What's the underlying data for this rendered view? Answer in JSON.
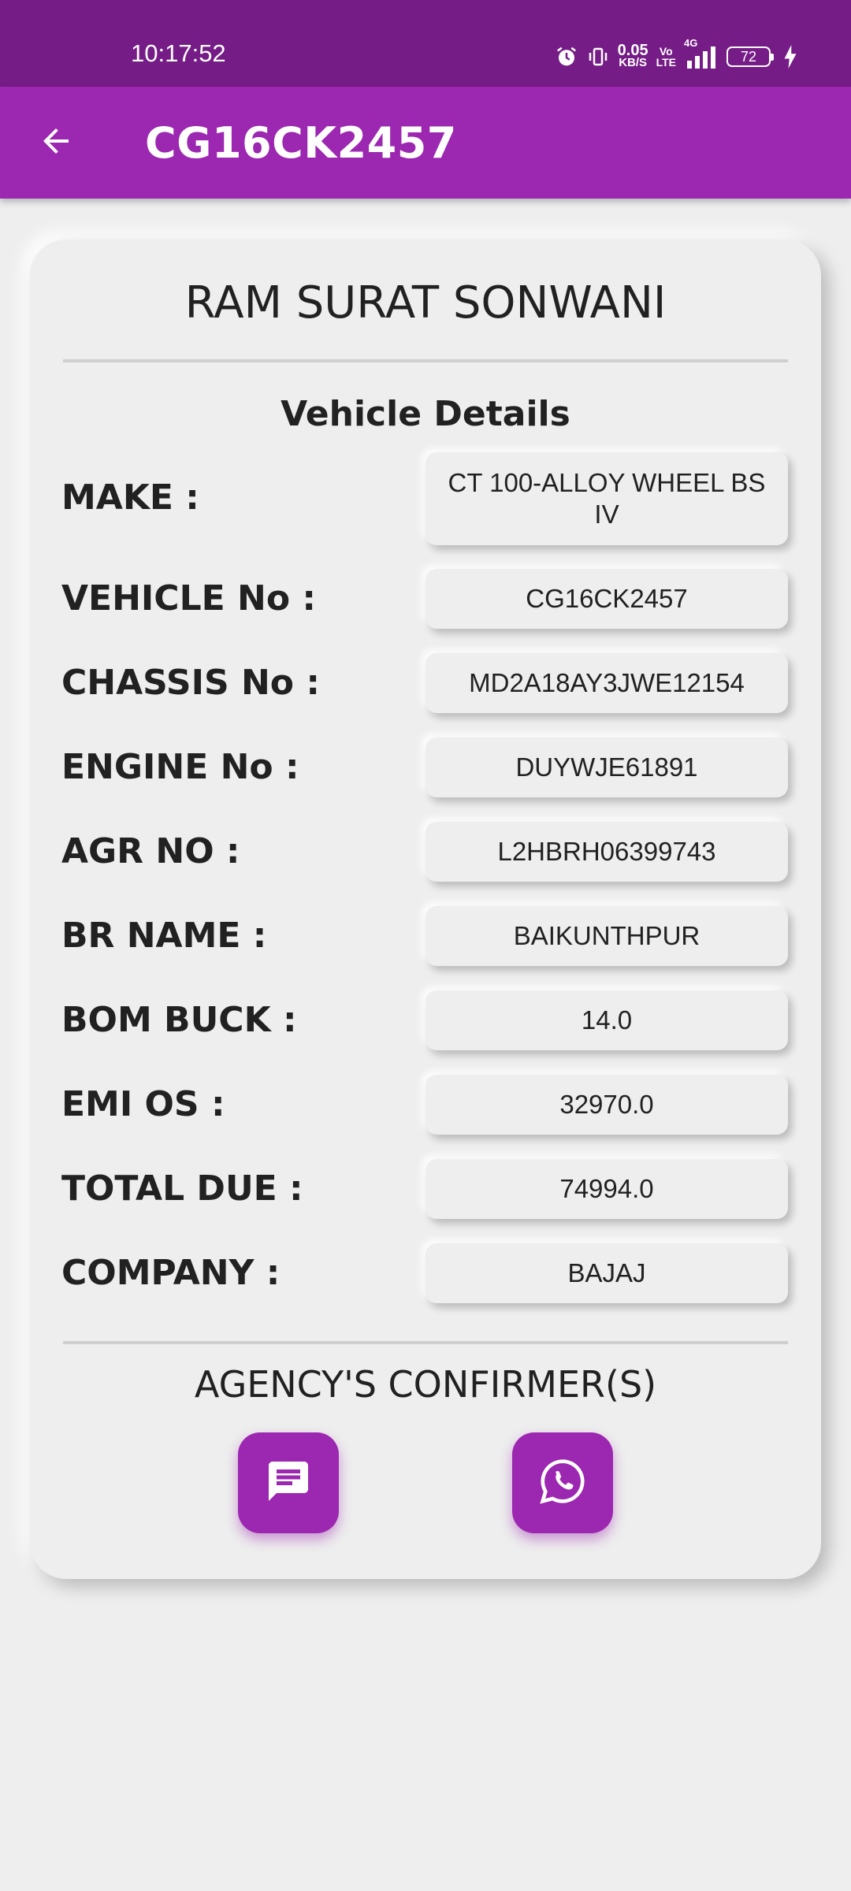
{
  "status_bar": {
    "time": "10:17:52",
    "net_speed_value": "0.05",
    "net_speed_unit": "KB/S",
    "volte_top": "Vo",
    "volte_bottom": "LTE",
    "network": "4G",
    "battery": "72",
    "icons": [
      "alarm-icon",
      "vibrate-icon",
      "signal-icon",
      "charging-icon"
    ]
  },
  "app_bar": {
    "title": "CG16CK2457",
    "back_icon": "arrow-back-icon"
  },
  "card": {
    "name": "RAM SURAT SONWANI",
    "section_title": "Vehicle Details",
    "rows": [
      {
        "label": "MAKE :",
        "value": "CT 100-ALLOY WHEEL BS IV"
      },
      {
        "label": "VEHICLE No :",
        "value": "CG16CK2457"
      },
      {
        "label": "CHASSIS No :",
        "value": "MD2A18AY3JWE12154"
      },
      {
        "label": "ENGINE No :",
        "value": "DUYWJE61891"
      },
      {
        "label": "AGR NO :",
        "value": "L2HBRH06399743"
      },
      {
        "label": "BR NAME :",
        "value": "BAIKUNTHPUR"
      },
      {
        "label": "BOM BUCK :",
        "value": "14.0"
      },
      {
        "label": "EMI OS :",
        "value": "32970.0"
      },
      {
        "label": "TOTAL DUE :",
        "value": "74994.0"
      },
      {
        "label": "COMPANY :",
        "value": "BAJAJ"
      }
    ],
    "agency_title": "AGENCY'S CONFIRMER(S)",
    "actions": [
      "message-icon",
      "whatsapp-icon"
    ]
  },
  "colors": {
    "status_bar": "#751c86",
    "app_bar": "#9c27b0",
    "background": "#eeeeee",
    "text": "#212121"
  }
}
